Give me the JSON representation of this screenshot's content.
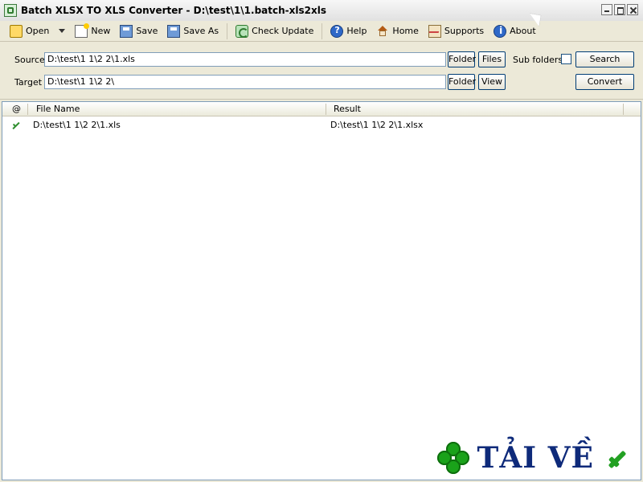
{
  "window": {
    "title": "Batch XLSX TO XLS Converter - D:\\test\\1\\1.batch-xls2xls"
  },
  "toolbar": {
    "items": [
      {
        "label": "Open",
        "icon": "open-folder-icon"
      },
      {
        "label": "New",
        "icon": "new-document-icon"
      },
      {
        "label": "Save",
        "icon": "save-icon"
      },
      {
        "label": "Save As",
        "icon": "save-as-icon"
      },
      {
        "label": "Check Update",
        "icon": "check-update-icon"
      },
      {
        "label": "Help",
        "icon": "help-icon"
      },
      {
        "label": "Home",
        "icon": "home-icon"
      },
      {
        "label": "Supports",
        "icon": "supports-icon"
      },
      {
        "label": "About",
        "icon": "about-icon"
      }
    ]
  },
  "form": {
    "source_label": "Source",
    "source_value": "D:\\test\\1 1\\2 2\\1.xls",
    "target_label": "Target",
    "target_value": "D:\\test\\1 1\\2 2\\",
    "folder_label": "Folder",
    "files_label": "Files",
    "view_label": "View",
    "subfolders_label": "Sub folders",
    "search_label": "Search",
    "convert_label": "Convert",
    "subfolders_checked": false
  },
  "list": {
    "columns": [
      "@",
      "File Name",
      "Result"
    ],
    "rows": [
      {
        "status_icon": "checkmark-icon",
        "file_name": "D:\\test\\1 1\\2 2\\1.xls",
        "result": "D:\\test\\1 1\\2 2\\1.xlsx"
      }
    ]
  },
  "watermark": {
    "text": "TẢI VỀ",
    "colors": {
      "text": "#0e2a7a",
      "clover": "#1aa21a",
      "check": "#22a022"
    }
  }
}
